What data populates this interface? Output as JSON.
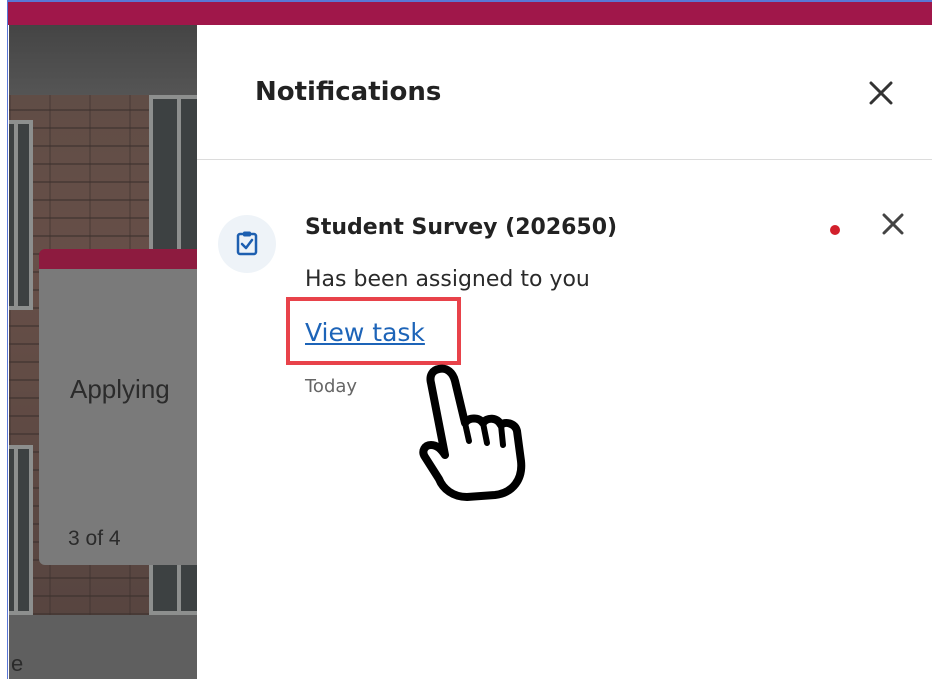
{
  "background": {
    "card_title": "Applying",
    "card_count": "3 of 4",
    "bottom_letter": "e"
  },
  "panel": {
    "title": "Notifications",
    "close_icon": "close-icon"
  },
  "notification": {
    "icon": "clipboard-check-icon",
    "title": "Student Survey (202650)",
    "body": "Has been assigned to you",
    "link_label": "View task",
    "time": "Today",
    "unread_color": "#d21f2b",
    "dismiss_icon": "close-icon"
  },
  "colors": {
    "topbar": "#a0174a",
    "link": "#1d64b8",
    "highlight": "#e8424a"
  },
  "annotation": {
    "pointer_icon": "pointing-hand-icon"
  }
}
